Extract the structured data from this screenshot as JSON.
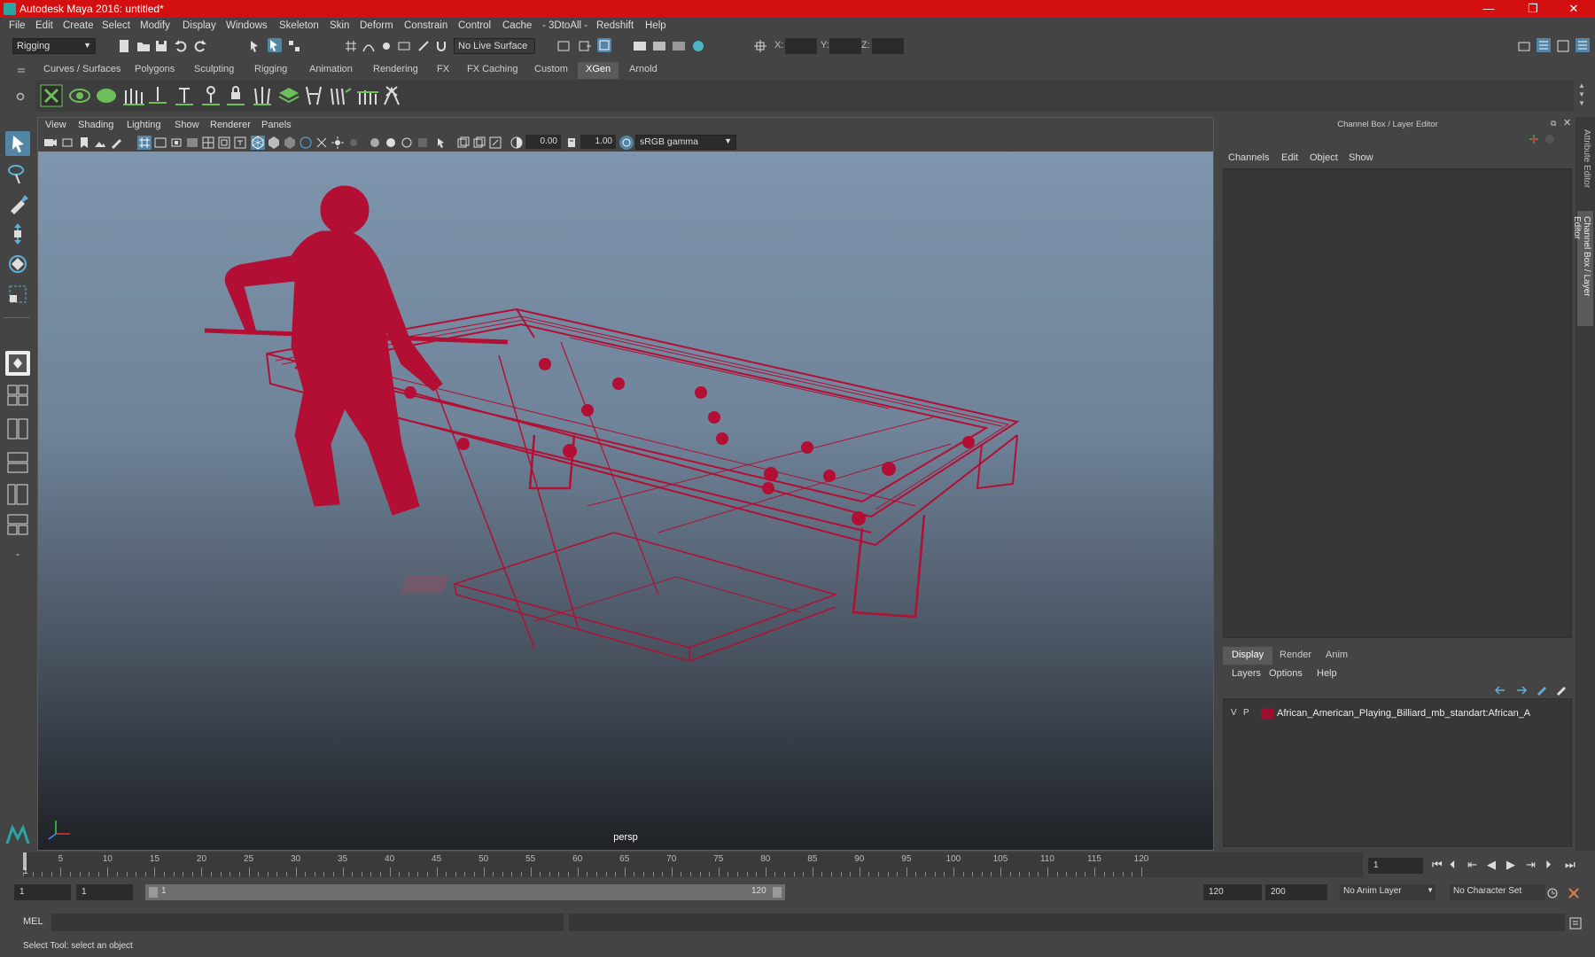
{
  "window": {
    "title": "Autodesk Maya 2016: untitled*",
    "minimize": "—",
    "restore": "❐",
    "close": "✕"
  },
  "menubar": [
    "File",
    "Edit",
    "Create",
    "Select",
    "Modify",
    "Display",
    "Windows",
    "Skeleton",
    "Skin",
    "Deform",
    "Constrain",
    "Control",
    "Cache",
    "- 3DtoAll -",
    "Redshift",
    "Help"
  ],
  "statusline": {
    "menuset": "Rigging",
    "live_surface": "No Live Surface",
    "x_label": "X:",
    "y_label": "Y:",
    "z_label": "Z:"
  },
  "shelf_tabs": [
    "Curves / Surfaces",
    "Polygons",
    "Sculpting",
    "Rigging",
    "Animation",
    "Rendering",
    "FX",
    "FX Caching",
    "Custom",
    "XGen",
    "Arnold"
  ],
  "shelf_active": "XGen",
  "shelf_icons": [
    "xgen-editor-icon",
    "xgen-preview-icon",
    "xgen-create-icon",
    "xgen-guides-icon",
    "xgen-place-guide-icon",
    "xgen-add-guide-icon",
    "xgen-select-guide-icon",
    "xgen-lock-icon",
    "xgen-grass-icon",
    "xgen-layers-icon",
    "xgen-sculpt-icon",
    "xgen-comb-icon",
    "xgen-cut-icon",
    "xgen-noise-icon"
  ],
  "viewport": {
    "menus": [
      "View",
      "Shading",
      "Lighting",
      "Show",
      "Renderer",
      "Panels"
    ],
    "exposure": "0.00",
    "gamma": "1.00",
    "color_space": "sRGB gamma",
    "camera": "persp"
  },
  "channelbox": {
    "title": "Channel Box / Layer Editor",
    "menus": [
      "Channels",
      "Edit",
      "Object",
      "Show"
    ],
    "layer_tabs": [
      "Display",
      "Render",
      "Anim"
    ],
    "layer_active": "Display",
    "layer_menus": [
      "Layers",
      "Options",
      "Help"
    ],
    "layers": [
      {
        "v": "V",
        "p": "P",
        "color": "#9b0f2c",
        "name": "African_American_Playing_Billiard_mb_standart:African_A"
      }
    ]
  },
  "side_tabs": [
    "Attribute Editor",
    "Channel Box / Layer Editor"
  ],
  "timeline": {
    "ticks": [
      "5",
      "10",
      "15",
      "20",
      "25",
      "30",
      "35",
      "40",
      "45",
      "50",
      "55",
      "60",
      "65",
      "70",
      "75",
      "80",
      "85",
      "90",
      "95",
      "100",
      "105",
      "110",
      "115",
      "120"
    ],
    "start_mark": "1",
    "current_frame": "1"
  },
  "range": {
    "start": "1",
    "anim_start": "1",
    "range_start": "1",
    "range_end": "120",
    "end": "120",
    "anim_end": "200",
    "anim_layer": "No Anim Layer",
    "character_set": "No Character Set"
  },
  "cmdline": {
    "label": "MEL"
  },
  "helpline": {
    "text": "Select Tool: select an object"
  },
  "colors": {
    "accent": "#5285a6",
    "wire": "#b30f34",
    "title": "#d40f0f"
  }
}
